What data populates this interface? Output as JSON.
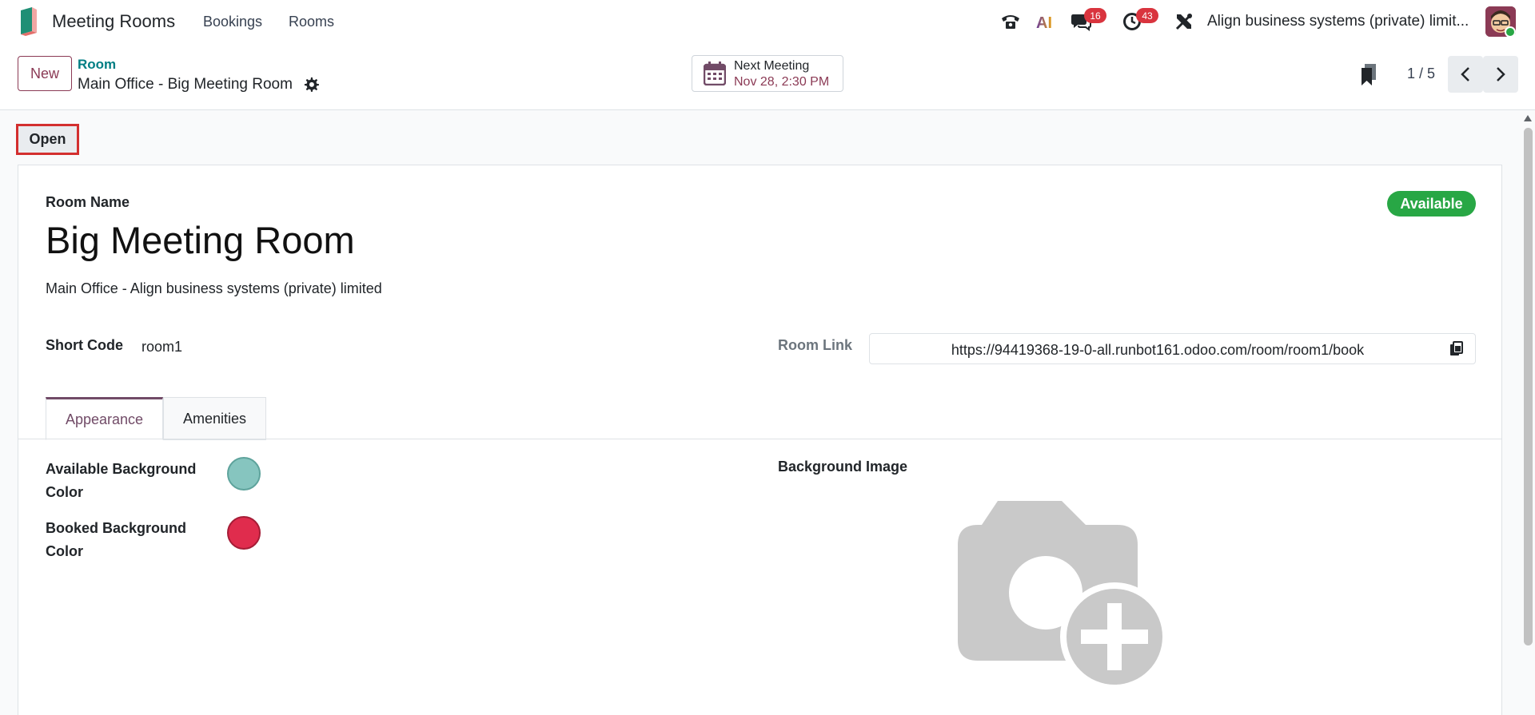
{
  "app": {
    "name": "Meeting Rooms",
    "logo_icon": "meeting-rooms-logo"
  },
  "nav": {
    "bookings": "Bookings",
    "rooms": "Rooms"
  },
  "systray": {
    "phone_icon": "phone-icon",
    "ai_icon": "ai-icon",
    "ai_text": "AI",
    "messages_icon": "chat-icon",
    "messages_count": "16",
    "activities_icon": "clock-icon",
    "activities_count": "43",
    "tools_icon": "tools-icon",
    "company": "Align business systems (private) limit..."
  },
  "control": {
    "new_label": "New",
    "breadcrumb_parent": "Room",
    "breadcrumb_current": "Main Office - Big Meeting Room",
    "smart_button": {
      "title": "Next Meeting",
      "value": "Nov 28, 2:30 PM"
    },
    "pager": "1 / 5"
  },
  "status": {
    "open_label": "Open"
  },
  "form": {
    "room_name_label": "Room Name",
    "room_name": "Big Meeting Room",
    "subtitle": "Main Office - Align business systems (private) limited",
    "status_badge": "Available",
    "short_code_label": "Short Code",
    "short_code": "room1",
    "room_link_label": "Room Link",
    "room_link": "https://94419368-19-0-all.runbot161.odoo.com/room/room1/book",
    "tabs": [
      {
        "label": "Appearance",
        "active": true
      },
      {
        "label": "Amenities",
        "active": false
      }
    ],
    "available_bg_label": "Available Background Color",
    "available_bg_color": "#86c5bf",
    "booked_bg_label": "Booked Background Color",
    "booked_bg_color": "#e02c4d",
    "background_image_label": "Background Image"
  },
  "colors": {
    "brand": "#714b67",
    "teal_link": "#017e84",
    "badge_red": "#d9343e",
    "success": "#28a745",
    "highlight_border": "#d32f2f"
  }
}
